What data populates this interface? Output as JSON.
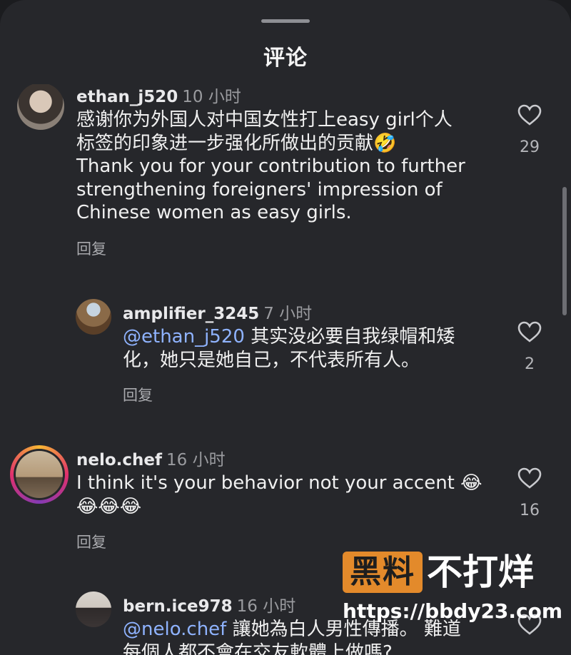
{
  "header": {
    "title": "评论"
  },
  "comments": [
    {
      "username": "ethan_j520",
      "time": "10 小时",
      "lines": [
        "感谢你为外国人对中国女性打上easy girl个人",
        "标签的印象进一步强化所做出的贡献",
        "Thank you for your contribution to further",
        "strengthening foreigners' impression of",
        "Chinese women as easy girls."
      ],
      "emoji": "🤣",
      "reply_label": "回复",
      "likes": "29"
    },
    {
      "username": "amplifier_3245",
      "time": "7 小时",
      "mention": "@ethan_j520",
      "line1_rest": " 其实没必要自我绿帽和矮",
      "line2": "化，她只是她自己，不代表所有人。",
      "reply_label": "回复",
      "likes": "2"
    },
    {
      "username": "nelo.chef",
      "time": "16 小时",
      "line1": "I think it's your behavior not your accent",
      "emoji_line1": "😂",
      "emoji_line2": "😂😂😂",
      "reply_label": "回复",
      "likes": "16"
    },
    {
      "username": "bern.ice978",
      "time": "16 小时",
      "mention": "@nelo.chef",
      "line1_rest": " 讓她為白人男性傳播。 難道",
      "line2": "每個人都不會在交友軟體上做嗎?"
    }
  ],
  "watermark": {
    "box": "黑料",
    "text": "不打烊",
    "url": "https://bbdy23.com"
  },
  "colors": {
    "background": "#26272b",
    "mention": "#8fb3ff",
    "watermark_orange": "#e38a2b"
  },
  "icons": {
    "like": "heart-outline-icon"
  }
}
